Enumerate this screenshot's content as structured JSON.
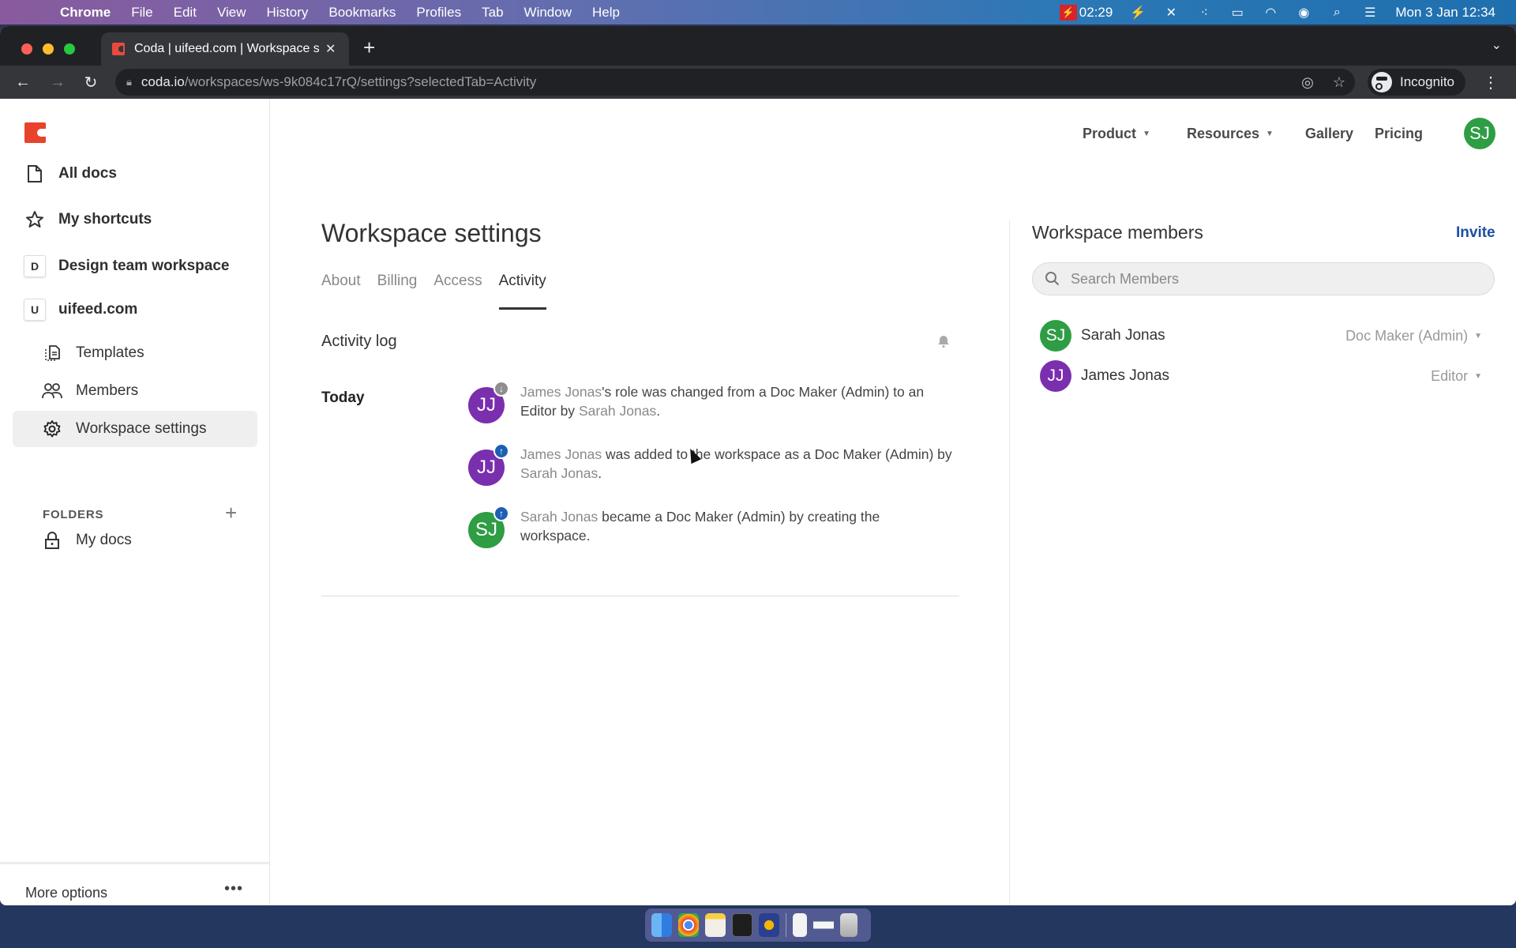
{
  "menubar": {
    "app_name": "Chrome",
    "menus": [
      "File",
      "Edit",
      "View",
      "History",
      "Bookmarks",
      "Profiles",
      "Tab",
      "Window",
      "Help"
    ],
    "recording_time": "02:29",
    "datetime": "Mon 3 Jan  12:34"
  },
  "browser": {
    "tab_title": "Coda | uifeed.com | Workspace settings",
    "url_domain": "coda.io",
    "url_path": "/workspaces/ws-9k084c17rQ/settings?selectedTab=Activity",
    "profile_label": "Incognito"
  },
  "sidebar": {
    "top_items": [
      {
        "label": "All docs",
        "icon": "document-icon"
      },
      {
        "label": "My shortcuts",
        "icon": "star-icon"
      }
    ],
    "workspaces": [
      {
        "initial": "D",
        "label": "Design team workspace"
      },
      {
        "initial": "U",
        "label": "uifeed.com"
      }
    ],
    "sub_items": [
      {
        "label": "Templates",
        "icon": "templates-icon"
      },
      {
        "label": "Members",
        "icon": "members-icon"
      },
      {
        "label": "Workspace settings",
        "icon": "gear-icon",
        "active": true
      }
    ],
    "folders_label": "FOLDERS",
    "folders": [
      {
        "label": "My docs",
        "icon": "lock-icon"
      }
    ],
    "more_options": "More options"
  },
  "topnav": {
    "links": [
      {
        "label": "Product",
        "dropdown": true
      },
      {
        "label": "Resources",
        "dropdown": true
      },
      {
        "label": "Gallery",
        "dropdown": false
      },
      {
        "label": "Pricing",
        "dropdown": false
      }
    ],
    "user_initials": "SJ"
  },
  "main": {
    "title": "Workspace settings",
    "tabs": [
      {
        "label": "About",
        "active": false
      },
      {
        "label": "Billing",
        "active": false
      },
      {
        "label": "Access",
        "active": false
      },
      {
        "label": "Activity",
        "active": true
      }
    ],
    "activity_log_title": "Activity log",
    "group_label": "Today",
    "entries": [
      {
        "initials": "JJ",
        "color": "#7a2fae",
        "badge": "down",
        "actor": "James Jonas",
        "text_1": "'s role was changed from a Doc Maker (Admin) to an Editor by ",
        "by": "Sarah Jonas",
        "end": "."
      },
      {
        "initials": "JJ",
        "color": "#7a2fae",
        "badge": "up",
        "actor": "James Jonas",
        "text_1": " was added to the workspace as a Doc Maker (Admin) by ",
        "by": "Sarah Jonas",
        "end": "."
      },
      {
        "initials": "SJ",
        "color": "#2e9d44",
        "badge": "up",
        "actor": "Sarah Jonas",
        "text_1": " became a Doc Maker (Admin) by creating the workspace.",
        "by": "",
        "end": ""
      }
    ]
  },
  "members_panel": {
    "title": "Workspace members",
    "invite_label": "Invite",
    "search_placeholder": "Search Members",
    "search_value": "",
    "members": [
      {
        "initials": "SJ",
        "color": "#2e9d44",
        "name": "Sarah Jonas",
        "role": "Doc Maker (Admin)"
      },
      {
        "initials": "JJ",
        "color": "#7a2fae",
        "name": "James Jonas",
        "role": "Editor"
      }
    ]
  },
  "dock": {
    "apps": [
      "Finder",
      "Chrome",
      "Notes",
      "Terminal",
      "Reeder",
      "Document",
      "Preview",
      "Trash"
    ]
  }
}
